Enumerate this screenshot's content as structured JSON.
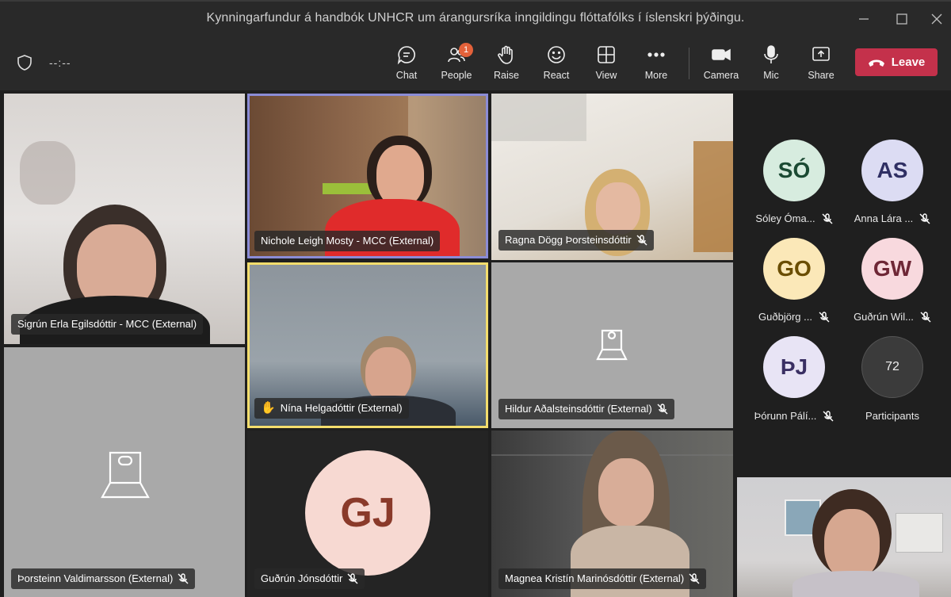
{
  "window": {
    "title": "Kynningarfundur á handbók UNHCR um árangursríka inngildingu flóttafólks í íslenskri þýðingu."
  },
  "toolbar": {
    "timer": "--:--",
    "chat_label": "Chat",
    "people_label": "People",
    "people_badge": "1",
    "raise_label": "Raise",
    "react_label": "React",
    "view_label": "View",
    "more_label": "More",
    "camera_label": "Camera",
    "mic_label": "Mic",
    "share_label": "Share",
    "leave_label": "Leave",
    "leave_color": "#c4314b"
  },
  "tiles": {
    "sigrun": "Sigrún Erla Egilsdóttir - MCC (External)",
    "nichole": "Nichole Leigh Mosty - MCC (External)",
    "ragna": "Ragna Dögg Þorsteinsdóttir",
    "nina": "Nína Helgadóttir (External)",
    "hildur": "Hildur Aðalsteinsdóttir (External)",
    "thorsteinn": "Þorsteinn Valdimarsson (External)",
    "gudrun": "Guðrún Jónsdóttir",
    "gudrun_initials": "GJ",
    "magnea": "Magnea Kristín Marinósdóttir (External)"
  },
  "side_panel": {
    "participants": [
      {
        "initials": "SÓ",
        "name": "Sóley Óma...",
        "bg": "#d7ecdf",
        "fg": "#1b4a33"
      },
      {
        "initials": "AS",
        "name": "Anna Lára ...",
        "bg": "#dcdcf3",
        "fg": "#2f2f63"
      },
      {
        "initials": "GO",
        "name": "Guðbjörg ...",
        "bg": "#fbe8b8",
        "fg": "#6a4d00"
      },
      {
        "initials": "GW",
        "name": "Guðrún Wil...",
        "bg": "#f8d9de",
        "fg": "#6e2736"
      },
      {
        "initials": "ÞJ",
        "name": "Þórunn Pálí...",
        "bg": "#e8e4f5",
        "fg": "#3a2f63"
      }
    ],
    "participant_count": "72",
    "participants_label": "Participants"
  },
  "colors": {
    "active_speaker_border": "#8b8cd6",
    "raised_hand_border": "#f3dd6d",
    "gj_avatar_bg": "#f7d9d2",
    "gj_avatar_fg": "#8a3a2a"
  }
}
